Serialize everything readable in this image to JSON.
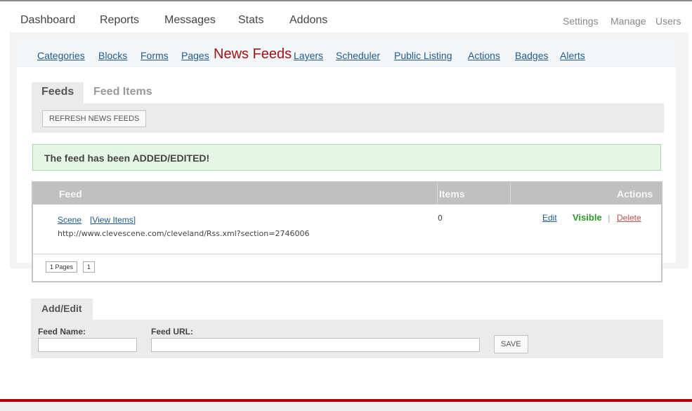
{
  "topnav": {
    "left": [
      "Dashboard",
      "Reports",
      "Messages",
      "Stats",
      "Addons"
    ],
    "right": [
      "Settings",
      "Manage",
      "Users"
    ]
  },
  "subnav": {
    "items": [
      "Categories",
      "Blocks",
      "Forms",
      "Pages",
      "News Feeds",
      "Layers",
      "Scheduler",
      "Public Listing",
      "Actions",
      "Badges",
      "Alerts"
    ],
    "active": "News Feeds"
  },
  "tabs": [
    "Feeds",
    "Feed Items"
  ],
  "toolbar": {
    "refresh_label": "REFRESH NEWS FEEDS"
  },
  "alert": {
    "message": "The feed has been ADDED/EDITED!"
  },
  "table": {
    "headers": {
      "feed": "Feed",
      "items": "Items",
      "actions": "Actions"
    },
    "rows": [
      {
        "name": "Scene",
        "view_items": "[View Items]",
        "url": "http://www.clevescene.com/cleveland/Rss.xml?section=2746006",
        "items": "0",
        "edit": "Edit",
        "visible": "Visible",
        "separator": "|",
        "delete": "Delete"
      }
    ],
    "pager": {
      "summary": "1 Pages",
      "page": "1"
    }
  },
  "addedit": {
    "title": "Add/Edit",
    "feed_name_label": "Feed Name:",
    "feed_url_label": "Feed URL:",
    "feed_name_value": "",
    "feed_url_value": "",
    "save_label": "SAVE"
  },
  "colors": {
    "link": "#1f5a8a",
    "active_subnav": "#a31212",
    "visible_green": "#2a9a2a",
    "delete_red": "#c0504d",
    "footer_red": "#b40000"
  }
}
